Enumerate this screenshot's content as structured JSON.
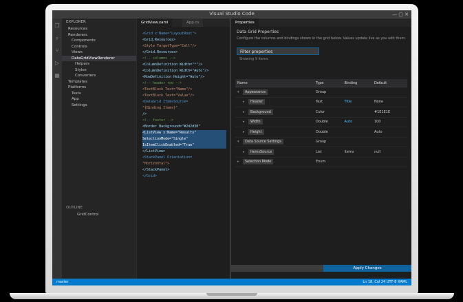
{
  "window": {
    "title": "Visual Studio Code"
  },
  "activity_icons": [
    "files-icon",
    "search-icon",
    "source-control-icon",
    "debug-icon",
    "extensions-icon"
  ],
  "explorer": {
    "title": "EXPLORER",
    "items": [
      {
        "label": "Resources",
        "indent": 1,
        "selected": false
      },
      {
        "label": "Renderers",
        "indent": 1,
        "selected": false
      },
      {
        "label": "Components",
        "indent": 2,
        "selected": false
      },
      {
        "label": "Controls",
        "indent": 2,
        "selected": false
      },
      {
        "label": "Views",
        "indent": 2,
        "selected": false
      },
      {
        "label": "DataGridViewRenderer",
        "indent": 2,
        "selected": true
      },
      {
        "label": "Helpers",
        "indent": 3,
        "selected": false
      },
      {
        "label": "Styles",
        "indent": 3,
        "selected": false
      },
      {
        "label": "Converters",
        "indent": 3,
        "selected": false
      },
      {
        "label": "Templates",
        "indent": 1,
        "selected": false
      },
      {
        "label": "Platforms",
        "indent": 1,
        "selected": false
      },
      {
        "label": "Tests",
        "indent": 2,
        "selected": false
      },
      {
        "label": "App",
        "indent": 2,
        "selected": false
      },
      {
        "label": "Settings",
        "indent": 2,
        "selected": false
      }
    ],
    "outline_title": "OUTLINE",
    "outline_item": "GridControl"
  },
  "left_editor": {
    "tabs": [
      {
        "label": "GridView.xaml",
        "active": true
      },
      {
        "label": "App.cs",
        "active": false
      }
    ],
    "lines": [
      {
        "text": "<Grid x:Name=\"LayoutRoot\">",
        "kind": "kw"
      },
      {
        "text": "  <Grid.Resources>",
        "kind": ""
      },
      {
        "text": "    <Style TargetType=\"Cell\"/>",
        "kind": "str"
      },
      {
        "text": "  </Grid.Resources>",
        "kind": ""
      },
      {
        "text": "  <!-- columns -->",
        "kind": "dim"
      },
      {
        "text": "  <ColumnDefinition Width=\"*\"/>",
        "kind": ""
      },
      {
        "text": "  <ColumnDefinition Width=\"Auto\"/>",
        "kind": ""
      },
      {
        "text": "  <RowDefinition Height=\"Auto\"/>",
        "kind": ""
      },
      {
        "text": "  <!-- header row -->",
        "kind": "dim"
      },
      {
        "text": "  <TextBlock Text=\"Name\"/>",
        "kind": "str"
      },
      {
        "text": "  <TextBlock Text=\"Value\"/>",
        "kind": "str"
      },
      {
        "text": "  <DataGrid ItemsSource=",
        "kind": "kw"
      },
      {
        "text": "    \"{Binding Items}\"",
        "kind": "str"
      },
      {
        "text": "  />",
        "kind": ""
      },
      {
        "text": "  <!-- footer -->",
        "kind": "dim"
      },
      {
        "text": "  <Border Background=\"#2d2d30\"",
        "kind": ""
      },
      {
        "text": "  <ListView x:Name=\"Results\"",
        "kind": "hl"
      },
      {
        "text": "    SelectionMode=\"Single\"",
        "kind": "hl"
      },
      {
        "text": "    IsItemClickEnabled=\"True\"",
        "kind": "hl"
      },
      {
        "text": "  </ListView>",
        "kind": ""
      },
      {
        "text": "  <StackPanel Orientation=",
        "kind": "kw"
      },
      {
        "text": "    \"Horizontal\">",
        "kind": "str"
      },
      {
        "text": "  </StackPanel>",
        "kind": ""
      },
      {
        "text": "</Grid>",
        "kind": "kw"
      }
    ]
  },
  "right_panel": {
    "tab": "Properties",
    "heading": "Data Grid Properties",
    "description": "Configure the columns and bindings shown in the grid below. Values update live as you edit them.",
    "search_value": "Filter properties",
    "search_hint": "Showing 9 items",
    "columns": [
      "Name",
      "Type",
      "Binding",
      "Default"
    ],
    "rows": [
      {
        "name": "Appearance",
        "type": "Group",
        "binding": "",
        "default": "",
        "indent": 0,
        "expand": "▾",
        "blue": false
      },
      {
        "name": "Header",
        "type": "Text",
        "binding": "Title",
        "default": "None",
        "indent": 1,
        "expand": "▸",
        "blue": true
      },
      {
        "name": "Background",
        "type": "Color",
        "binding": "",
        "default": "#1E1E1E",
        "indent": 1,
        "expand": "▸",
        "blue": false
      },
      {
        "name": "Width",
        "type": "Double",
        "binding": "Auto",
        "default": "100",
        "indent": 1,
        "expand": "▸",
        "blue": true
      },
      {
        "name": "Height",
        "type": "Double",
        "binding": "",
        "default": "Auto",
        "indent": 1,
        "expand": "▸",
        "blue": false
      },
      {
        "name": "Data Source Settings",
        "type": "Group",
        "binding": "",
        "default": "",
        "indent": 0,
        "expand": "▾",
        "blue": false
      },
      {
        "name": "ItemsSource",
        "type": "List",
        "binding": "Items",
        "default": "null",
        "indent": 1,
        "expand": "▸",
        "blue": false
      },
      {
        "name": "Selection Mode",
        "type": "Enum",
        "binding": "",
        "default": "",
        "indent": 0,
        "expand": "▸",
        "blue": false
      }
    ],
    "bottom_button": "Apply Changes"
  },
  "statusbar": {
    "left": "master",
    "right": "Ln 18, Col 24   UTF-8   XAML"
  }
}
